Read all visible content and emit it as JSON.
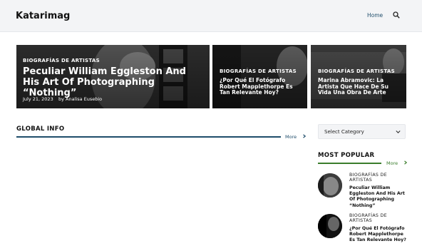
{
  "header": {
    "logo": "Katarimag",
    "nav_home": "Home",
    "search_icon": "search-icon"
  },
  "featured": [
    {
      "category": "BIOGRAFÍAS DE ARTISTAS",
      "title": "Peculiar William Eggleston And His Art Of Photographing “Nothing”",
      "date": "July 21, 2023",
      "author": "by Analisa Eusebio"
    },
    {
      "category": "BIOGRAFÍAS DE ARTISTAS",
      "title": "¿Por Qué El Fotógrafo Robert Mapplethorpe Es Tan Relevante Hoy?"
    },
    {
      "category": "BIOGRAFÍAS DE ARTISTAS",
      "title": "Marina Abramovic: La Artista Que Hace De Su Vida Una Obra De Arte"
    }
  ],
  "global_info": {
    "title": "GLOBAL INFO",
    "more": "More",
    "accent": "#1f4d6b"
  },
  "sidebar": {
    "select_category": "Select Category",
    "most_popular": {
      "title": "MOST POPULAR",
      "more": "More",
      "accent": "#3a7d2c",
      "items": [
        {
          "category": "BIOGRAFÍAS DE ARTISTAS",
          "title": "Peculiar William Eggleston And His Art Of Photographing “Nothing”"
        },
        {
          "category": "BIOGRAFÍAS DE ARTISTAS",
          "title": "¿Por Qué El Fotógrafo Robert Mapplethorpe Es Tan Relevante Hoy?"
        }
      ]
    }
  }
}
